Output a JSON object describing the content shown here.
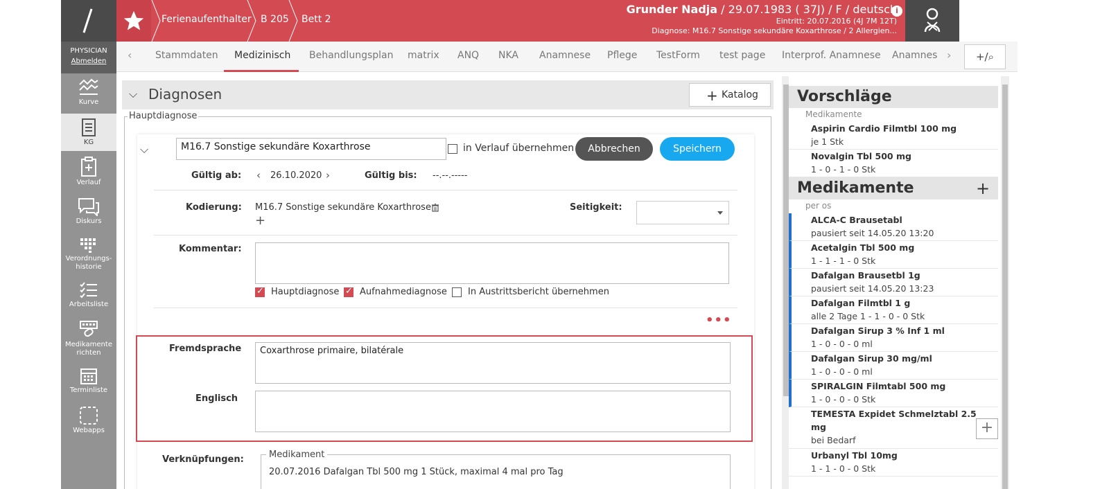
{
  "nav": {
    "role": "PHYSICIAN",
    "logout": "Abmelden",
    "items": [
      {
        "label": "Kurve"
      },
      {
        "label": "KG"
      },
      {
        "label": "Verlauf"
      },
      {
        "label": "Diskurs"
      },
      {
        "label": "Verordnungs-",
        "label2": "historie"
      },
      {
        "label": "Arbeitsliste"
      },
      {
        "label": "Medikamente",
        "label2": "richten"
      },
      {
        "label": "Terminliste"
      },
      {
        "label": "Webapps"
      }
    ]
  },
  "header": {
    "breadcrumbs": [
      "Ferienaufenthalter",
      "B 205",
      "Bett 2"
    ],
    "patient_name": "Grunder Nadja",
    "patient_meta": " / 29.07.1983 ( 37J) / F / deutsch",
    "entry": "Eintritt: 20.07.2016 (4J 7M 12T)",
    "diagnosis": "Diagnose: M16.7 Sonstige sekundäre Koxarthrose / 2 Allergien...",
    "info_icon": "i",
    "accent_color": "#d34a52"
  },
  "tabs": {
    "items": [
      "Stammdaten",
      "Medizinisch",
      "Behandlungsplan",
      "matrix",
      "ANQ",
      "NKA",
      "Anamnese",
      "Pflege",
      "TestForm",
      "test page",
      "Interprof. Anamnese",
      "Anamnes"
    ],
    "active": "Medizinisch",
    "search_label": "+/⌕"
  },
  "section": {
    "title": "Diagnosen",
    "katalog": "Katalog",
    "hauptdiagnose_legend": "Hauptdiagnose"
  },
  "diagnosis": {
    "value": "M16.7 Sonstige sekundäre Koxarthrose",
    "verlauf_label": "in Verlauf übernehmen",
    "cancel": "Abbrechen",
    "save": "Speichern",
    "gueltig_ab_label": "Gültig ab:",
    "gueltig_ab": "26.10.2020",
    "gueltig_bis_label": "Gültig bis:",
    "gueltig_bis": "--.--.-----",
    "kodierung_label": "Kodierung:",
    "kodierung": "M16.7 Sonstige sekundäre Koxarthrose",
    "seitigkeit_label": "Seitigkeit:",
    "kommentar_label": "Kommentar:",
    "cb_haupt": "Hauptdiagnose",
    "cb_aufnahme": "Aufnahmediagnose",
    "cb_austritt": "In Austrittsbericht übernehmen",
    "fremdsprache_label": "Fremdsprache",
    "fremdsprache": "Coxarthrose primaire, bilatérale",
    "englisch_label": "Englisch",
    "verknuepfungen_label": "Verknüpfungen:",
    "medikament_legend": "Medikament",
    "medikament_entry": "20.07.2016 Dafalgan Tbl 500 mg 1 Stück, maximal 4 mal pro Tag"
  },
  "right": {
    "vorschlaege_title": "Vorschläge",
    "vorschlaege_sub": "Medikamente",
    "vorschlaege": [
      {
        "name": "Aspirin Cardio Filmtbl 100 mg",
        "detail": "je 1 Stk"
      },
      {
        "name": "Novalgin Tbl 500 mg",
        "detail": "1 - 0 - 1 - 0 Stk"
      }
    ],
    "medikamente_title": "Medikamente",
    "medikamente_sub": "per os",
    "medikamente": [
      {
        "name": "ALCA-C Brausetabl",
        "detail": "pausiert seit 14.05.20 13:20"
      },
      {
        "name": "Acetalgin Tbl 500 mg",
        "detail": "1 - 1 - 1 - 0 Stk"
      },
      {
        "name": "Dafalgan Brausetbl 1g",
        "detail": "pausiert seit 14.05.20 13:23"
      },
      {
        "name": "Dafalgan Filmtbl 1 g",
        "detail": "alle 2 Tage 1 - 1 - 0 - 0 Stk"
      },
      {
        "name": "Dafalgan Sirup 3 % Inf 1 ml",
        "detail": "1 - 0 - 0 - 0 ml"
      },
      {
        "name": "Dafalgan Sirup 30 mg/ml",
        "detail": "1 - 0 - 0 - 0 ml"
      },
      {
        "name": "SPIRALGIN Filmtabl 500 mg",
        "detail": "1 - 0 - 0 - 0 Stk"
      }
    ],
    "temesta_name": "TEMESTA Expidet Schmelztabl 2.5",
    "temesta_name2": "mg",
    "temesta_detail": "bei Bedarf",
    "urbanyl_name": "Urbanyl Tbl 10mg",
    "urbanyl_detail": "1 - 1 - 0 - 0 Stk"
  }
}
